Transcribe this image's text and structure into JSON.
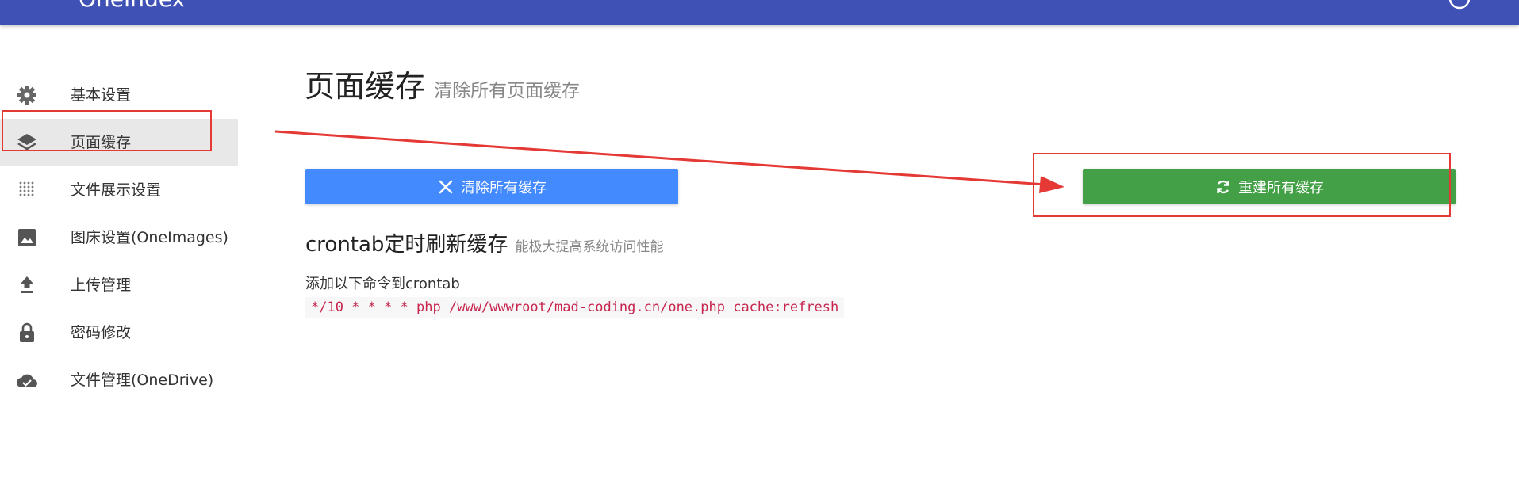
{
  "header": {
    "brand": "OneIndex"
  },
  "sidebar": {
    "items": [
      {
        "label": "基本设置",
        "icon": "gear-icon"
      },
      {
        "label": "页面缓存",
        "icon": "layers-icon",
        "active": true
      },
      {
        "label": "文件展示设置",
        "icon": "grid-dots-icon"
      },
      {
        "label": "图床设置(OneImages)",
        "icon": "image-icon"
      },
      {
        "label": "上传管理",
        "icon": "upload-icon"
      },
      {
        "label": "密码修改",
        "icon": "lock-icon"
      },
      {
        "label": "文件管理(OneDrive)",
        "icon": "cloud-check-icon"
      }
    ]
  },
  "main": {
    "title": "页面缓存",
    "subtitle": "清除所有页面缓存",
    "clear_button": "清除所有缓存",
    "rebuild_button": "重建所有缓存",
    "crontab_title": "crontab定时刷新缓存",
    "crontab_subtitle": "能极大提高系统访问性能",
    "cmd_intro": "添加以下命令到crontab",
    "cmd": "*/10 * * * * php /www/wwwroot/mad-coding.cn/one.php cache:refresh"
  },
  "colors": {
    "header": "#3f51b5",
    "clear_button": "#448aff",
    "rebuild_button": "#43a047",
    "annotation": "#e53935",
    "code_text": "#c7254e"
  }
}
